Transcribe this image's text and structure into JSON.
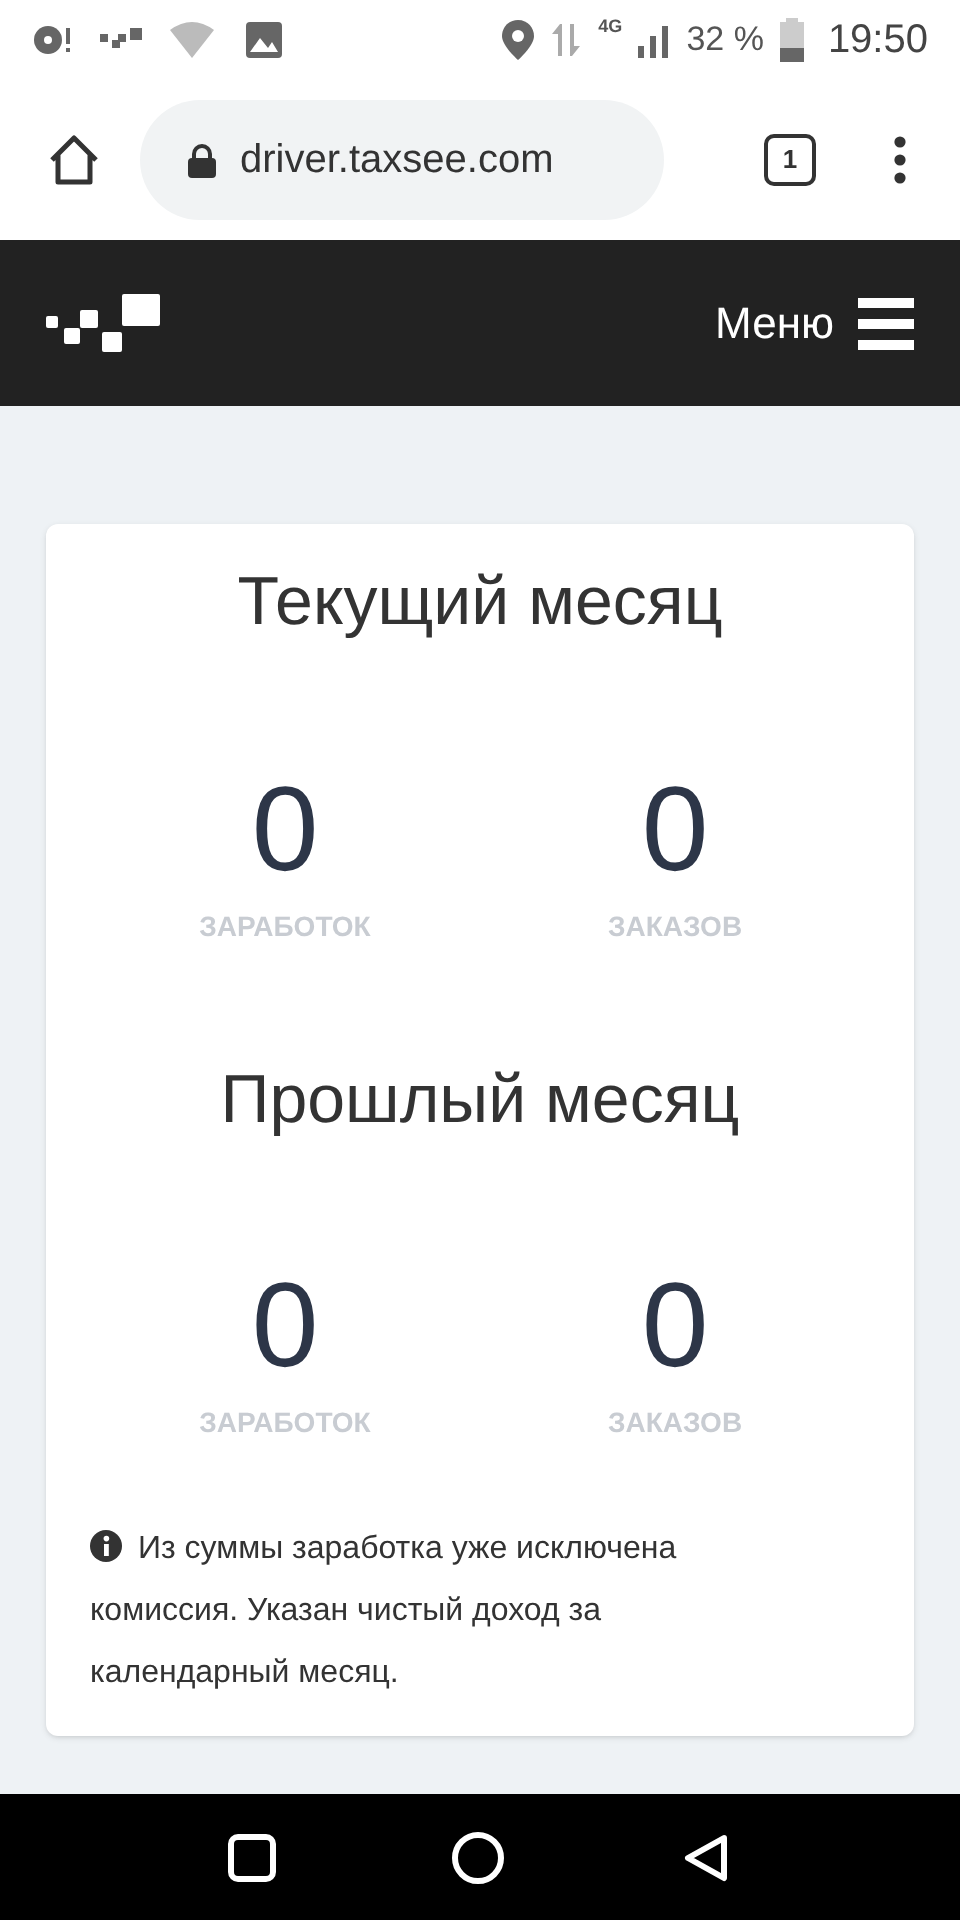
{
  "status_bar": {
    "battery": "32 %",
    "network": "4G",
    "time": "19:50"
  },
  "browser": {
    "url": "driver.taxsee.com",
    "tab_count": "1"
  },
  "header": {
    "menu_label": "Меню"
  },
  "sections": [
    {
      "title": "Текущий месяц",
      "stats": [
        {
          "value": "0",
          "label": "ЗАРАБОТОК"
        },
        {
          "value": "0",
          "label": "ЗАКАЗОВ"
        }
      ]
    },
    {
      "title": "Прошлый месяц",
      "stats": [
        {
          "value": "0",
          "label": "ЗАРАБОТОК"
        },
        {
          "value": "0",
          "label": "ЗАКАЗОВ"
        }
      ]
    }
  ],
  "note": "Из суммы заработка уже исключена комиссия. Указан чистый доход за календарный месяц."
}
